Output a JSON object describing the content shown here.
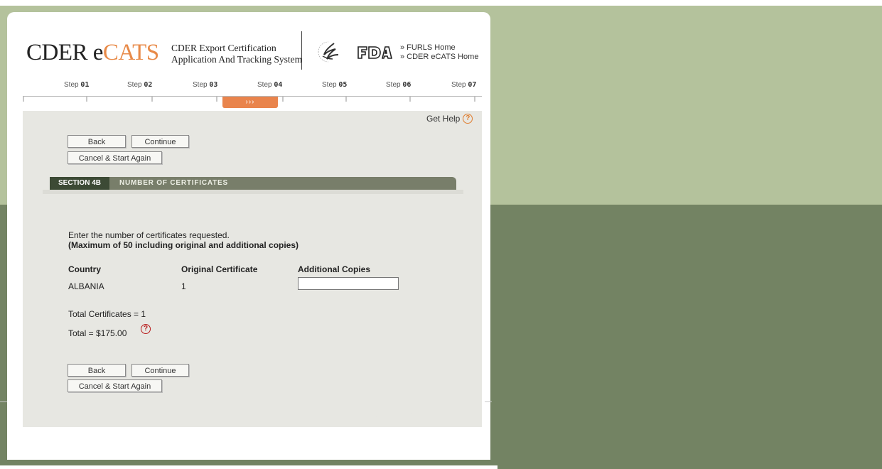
{
  "header": {
    "logo_text_main": "CDER e",
    "logo_text_accent": "CATS",
    "app_title_line1": "CDER Export Certification",
    "app_title_line2": "Application And Tracking System",
    "links": [
      {
        "label": "»  FURLS Home"
      },
      {
        "label": "»  CDER eCATS Home"
      }
    ]
  },
  "steps": [
    {
      "prefix": "Step ",
      "num": "01"
    },
    {
      "prefix": "Step ",
      "num": "02"
    },
    {
      "prefix": "Step ",
      "num": "03"
    },
    {
      "prefix": "Step ",
      "num": "04"
    },
    {
      "prefix": "Step ",
      "num": "05"
    },
    {
      "prefix": "Step ",
      "num": "06"
    },
    {
      "prefix": "Step ",
      "num": "07"
    }
  ],
  "current_step_marker": "›››",
  "get_help_label": "Get Help",
  "help_glyph": "?",
  "buttons": {
    "back": "Back",
    "continue": "Continue",
    "cancel": "Cancel & Start Again"
  },
  "section": {
    "label": "SECTION 4B",
    "title": "NUMBER OF CERTIFICATES"
  },
  "form": {
    "instruction": "Enter the number of certificates requested.",
    "instruction_note": "(Maximum of 50 including original and additional copies)",
    "columns": [
      "Country",
      "Original Certificate",
      "Additional Copies"
    ],
    "row": {
      "country": "ALBANIA",
      "original": "1",
      "additional": ""
    },
    "total_certificates": "Total Certificates = 1",
    "total_amount": "Total = $175.00"
  },
  "colors": {
    "accent_orange": "#e9844c",
    "section_dark": "#3c4a35",
    "section_bar": "#787e6a",
    "bg_light": "#b4c29c",
    "bg_dark": "#738363"
  }
}
